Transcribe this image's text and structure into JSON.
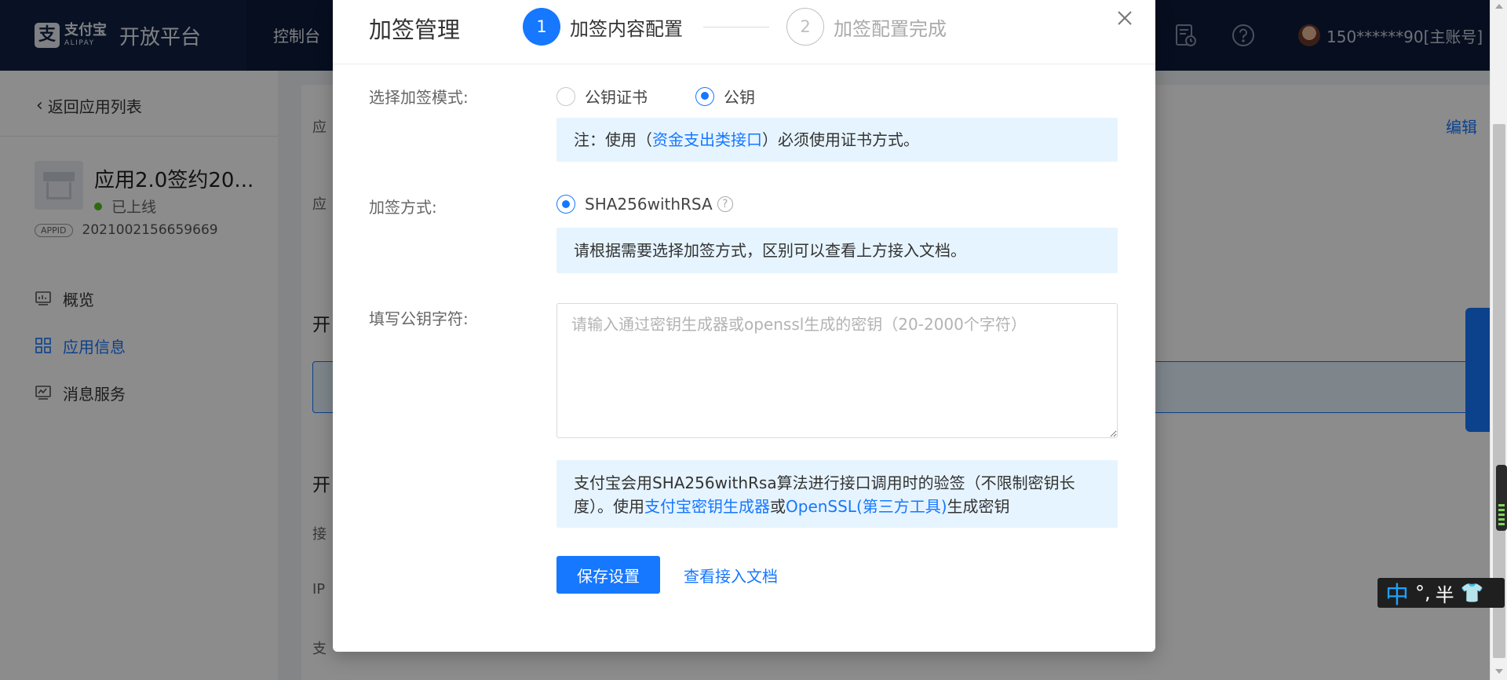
{
  "topnav": {
    "logo_cn": "支付宝",
    "logo_en": "ALIPAY",
    "platform": "开放平台",
    "console": "控制台",
    "user": "150******90[主账号]"
  },
  "sidebar": {
    "back": "返回应用列表",
    "app_name": "应用2.0签约20...",
    "app_status": "已上线",
    "appid_badge": "APPID",
    "appid": "2021002156659669",
    "items": [
      {
        "label": "概览"
      },
      {
        "label": "应用信息"
      },
      {
        "label": "消息服务"
      }
    ]
  },
  "background": {
    "edit": "编辑",
    "frag_1": "应",
    "frag_2": "应",
    "section_1": "开",
    "section_2": "开",
    "frag_3": "接",
    "frag_4": "IP",
    "frag_5": "支"
  },
  "modal": {
    "title": "加签管理",
    "steps": [
      {
        "number": "1",
        "label": "加签内容配置"
      },
      {
        "number": "2",
        "label": "加签配置完成"
      }
    ],
    "mode_label": "选择加签模式:",
    "mode_options": [
      "公钥证书",
      "公钥"
    ],
    "mode_selected": "公钥",
    "mode_note_prefix": "注：使用（",
    "mode_note_link": "资金支出类接口",
    "mode_note_suffix": "）必须使用证书方式。",
    "method_label": "加签方式:",
    "method_option": "SHA256withRSA",
    "method_note": "请根据需要选择加签方式，区别可以查看上方接入文档。",
    "key_label": "填写公钥字符:",
    "key_placeholder": "请输入通过密钥生成器或openssl生成的密钥（20-2000个字符）",
    "key_value": "",
    "info_prefix": "支付宝会用SHA256withRsa算法进行接口调用时的验签（不限制密钥长度）。使用",
    "info_link_1": "支付宝密钥生成器",
    "info_mid": "或",
    "info_link_2": "OpenSSL(第三方工具)",
    "info_suffix": "生成密钥",
    "save_button": "保存设置",
    "doc_link": "查看接入文档"
  },
  "ime": {
    "mode": "中",
    "punct": "°,",
    "width": "半"
  },
  "colors": {
    "primary": "#1677ff",
    "nav_bg": "#0c1b3b",
    "note_bg": "#e6f4ff",
    "online": "#52c41a"
  }
}
